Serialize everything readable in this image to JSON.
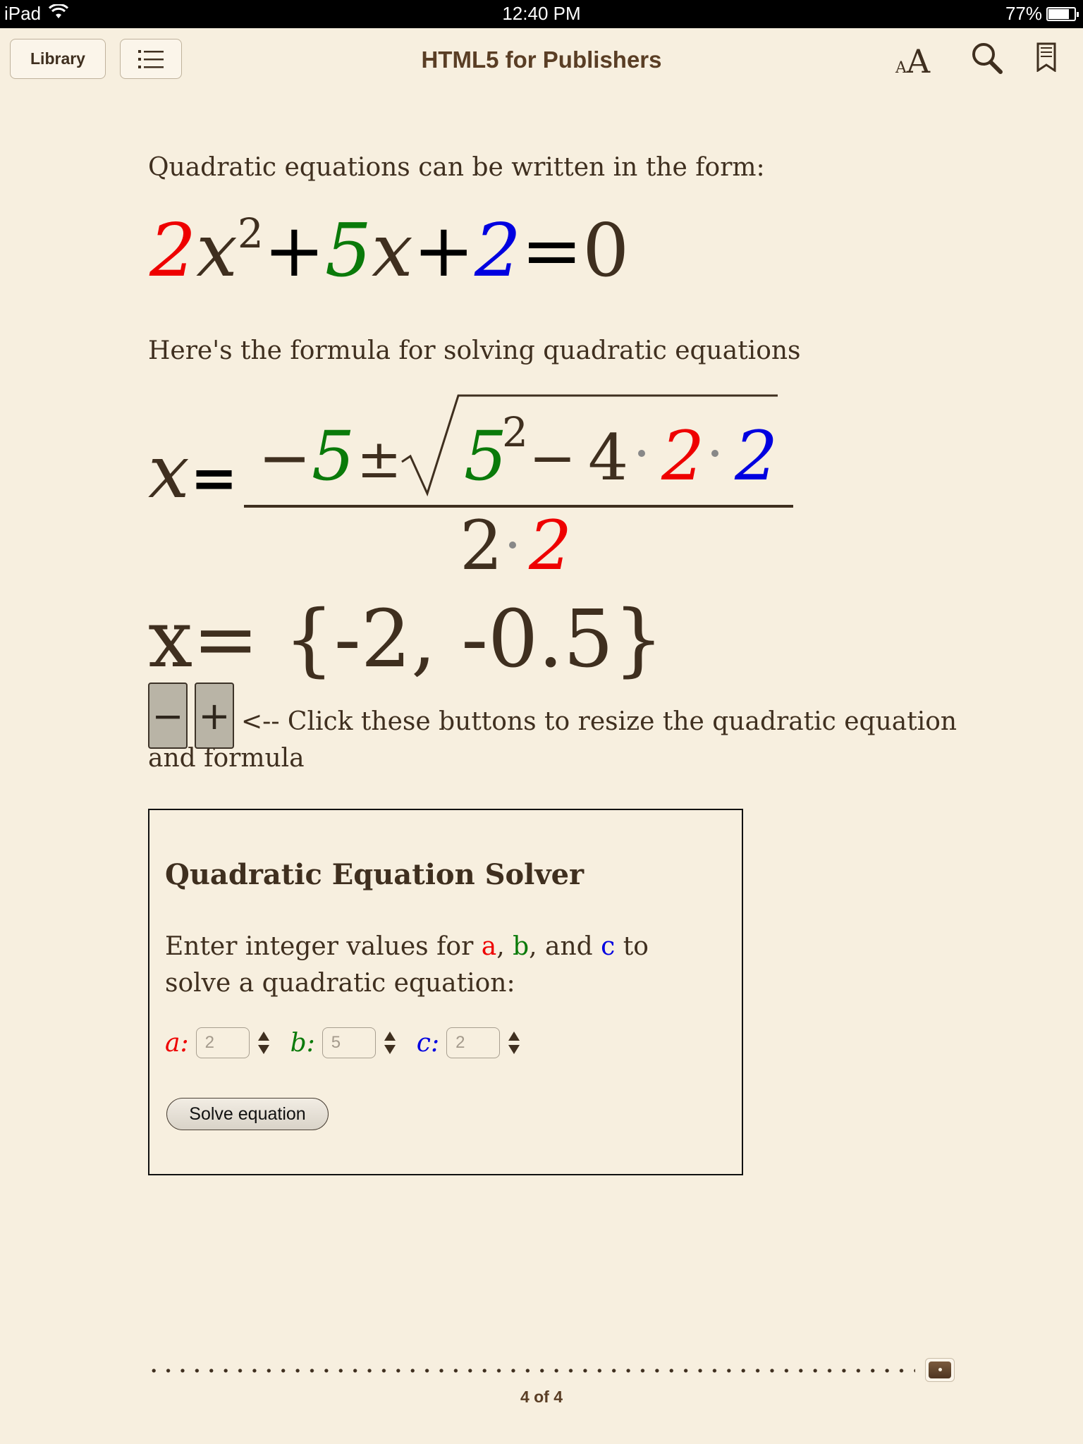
{
  "status": {
    "device": "iPad",
    "time": "12:40 PM",
    "battery": "77%",
    "battery_level": 0.77
  },
  "toolbar": {
    "library_label": "Library",
    "title": "HTML5 for Publishers",
    "font_small": "A",
    "font_large": "A",
    "icons": [
      "toc-list-icon",
      "font-size-icon",
      "search-icon",
      "bookmark-icon"
    ]
  },
  "page": {
    "intro": "Quadratic equations can be written in the form:",
    "equation": {
      "a": "2",
      "x1": "x",
      "exp": "2",
      "plus1": "+",
      "b": "5",
      "x2": "x",
      "plus2": "+",
      "c": "2",
      "equals": "=",
      "zero": "0"
    },
    "formula_intro": "Here's the formula for solving quadratic equations",
    "formula": {
      "lhs": "x",
      "equals": "=",
      "neg": "−",
      "b": "5",
      "pm": "±",
      "b2": "5",
      "sq": "2",
      "minus": "−",
      "four": "4",
      "a": "2",
      "c": "2",
      "den_two": "2",
      "den_a": "2"
    },
    "result": {
      "lhs": "x",
      "equals": "=",
      "value": "{-2, -0.5}"
    },
    "resize": {
      "minus": "−",
      "plus": "+",
      "text": "<-- Click these buttons to resize the quadratic equation and formula"
    }
  },
  "solver": {
    "title": "Quadratic Equation Solver",
    "desc_prefix": "Enter integer values for ",
    "desc_a": "a",
    "desc_sep1": ", ",
    "desc_b": "b",
    "desc_sep2": ", and ",
    "desc_c": "c",
    "desc_suffix": " to solve a quadratic equation:",
    "label_a": "a:",
    "label_b": "b:",
    "label_c": "c:",
    "value_a": "2",
    "value_b": "5",
    "value_c": "2",
    "button": "Solve equation"
  },
  "footer": {
    "page_indicator": "4 of 4"
  },
  "colors": {
    "a": "#ee0000",
    "b": "#0a7a0a",
    "c": "#0000e0",
    "text": "#3f2f1f",
    "background": "#f7efdf"
  }
}
